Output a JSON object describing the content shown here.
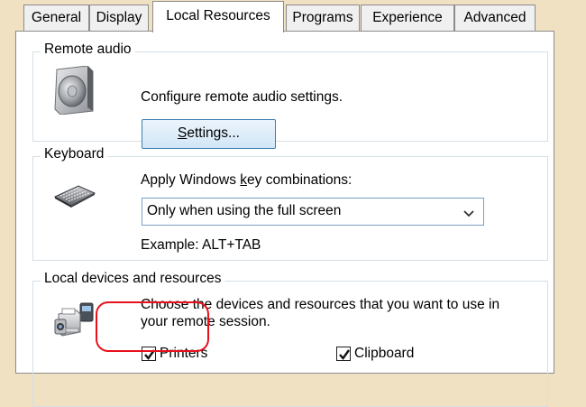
{
  "tabs": [
    {
      "label": "General"
    },
    {
      "label": "Display"
    },
    {
      "label": "Local Resources"
    },
    {
      "label": "Programs"
    },
    {
      "label": "Experience"
    },
    {
      "label": "Advanced"
    }
  ],
  "active_tab": "Local Resources",
  "remote_audio": {
    "title": "Remote audio",
    "description": "Configure remote audio settings.",
    "settings_button": {
      "before": "",
      "underlined": "S",
      "after": "ettings..."
    },
    "icon": "speaker-icon"
  },
  "keyboard": {
    "title": "Keyboard",
    "label": {
      "before": "Apply Windows ",
      "underlined": "k",
      "after": "ey combinations:"
    },
    "selected_option": "Only when using the full screen",
    "example": "Example: ALT+TAB",
    "icon": "keyboard-icon"
  },
  "local_devices": {
    "title": "Local devices and resources",
    "description_line1": "Choose the devices and resources that you want to use in",
    "description_line2": "your remote session.",
    "icon": "devices-icon",
    "checkboxes": [
      {
        "label": "Printers",
        "checked": true,
        "highlighted": true
      },
      {
        "label": "Clipboard",
        "checked": true,
        "highlighted": false
      }
    ]
  },
  "colors": {
    "frame": "#f0e1c3",
    "highlight_ring": "#e8101a",
    "button_border": "#3c7fb1"
  }
}
